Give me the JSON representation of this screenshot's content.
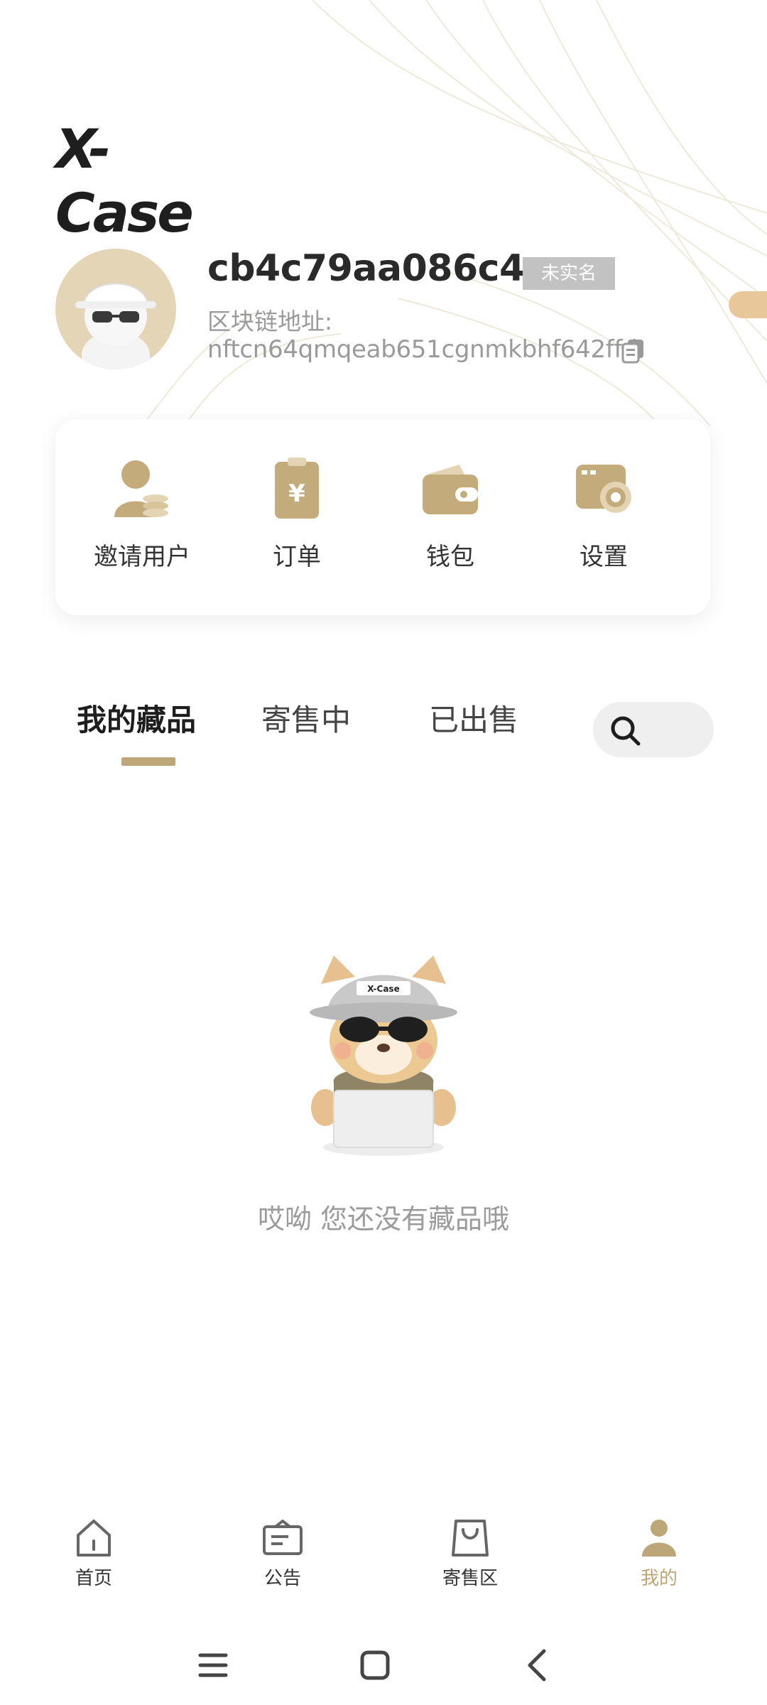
{
  "app": {
    "logo_text": "X-Case"
  },
  "profile": {
    "username": "cb4c79aa086c4…",
    "kyc_status": "未实名",
    "chain_label": "区块链地址:",
    "chain_address": "nftcn64qmqeab651cgnmkbhf642ffd"
  },
  "quick_actions": [
    {
      "label": "邀请用户",
      "icon": "invite-user-icon"
    },
    {
      "label": "订单",
      "icon": "order-icon"
    },
    {
      "label": "钱包",
      "icon": "wallet-icon"
    },
    {
      "label": "设置",
      "icon": "settings-icon"
    }
  ],
  "tabs": [
    {
      "label": "我的藏品",
      "active": true
    },
    {
      "label": "寄售中",
      "active": false
    },
    {
      "label": "已出售",
      "active": false
    }
  ],
  "empty_state": {
    "message": "哎呦 您还没有藏品哦"
  },
  "bottom_nav": [
    {
      "label": "首页",
      "icon": "home-icon",
      "active": false
    },
    {
      "label": "公告",
      "icon": "announcement-icon",
      "active": false
    },
    {
      "label": "寄售区",
      "icon": "shopping-bag-icon",
      "active": false
    },
    {
      "label": "我的",
      "icon": "profile-icon",
      "active": true
    }
  ],
  "colors": {
    "accent": "#bda677",
    "icon_gold": "#c3ab7c",
    "muted_text": "#9a9a9a"
  }
}
